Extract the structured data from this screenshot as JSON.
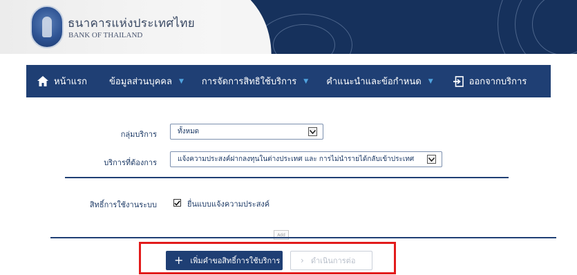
{
  "brand": {
    "name_th": "ธนาคารแห่งประเทศไทย",
    "name_en": "BANK OF THAILAND"
  },
  "nav": {
    "home": "หน้าแรก",
    "personal_info": "ข้อมูลส่วนบุคคล",
    "manage_rights": "การจัดการสิทธิใช้บริการ",
    "guidance": "คำแนะนำและข้อกำหนด",
    "logout": "ออกจากบริการ"
  },
  "form": {
    "service_group_label": "กลุ่มบริการ",
    "service_group_value": "ทั้งหมด",
    "service_label": "บริการที่ต้องการ",
    "service_value": "แจ้งความประสงค์ฝากลงทุนในต่างประเทศ และ การไม่นำรายได้กลับเข้าประเทศ",
    "rights_label": "สิทธิ์การใช้งานระบบ",
    "rights_option": "ยื่นแบบแจ้งความประสงค์",
    "rights_checked": true,
    "add_tag": "Add"
  },
  "actions": {
    "add_request": "เพิ่มคำขอสิทธิ์การใช้บริการ",
    "proceed": "ดำเนินการต่อ"
  },
  "colors": {
    "navy": "#1f3f74",
    "banner_navy": "#16315c",
    "nav_caret": "#4fa3e0",
    "highlight": "#e21b1b"
  }
}
